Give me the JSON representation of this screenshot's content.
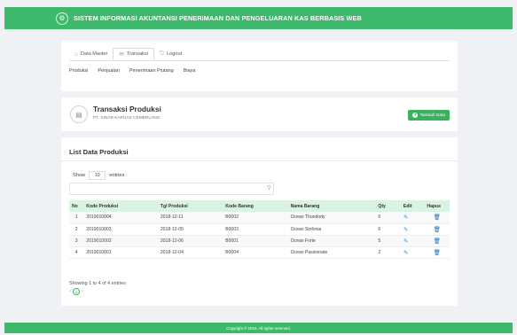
{
  "header": {
    "title": "SISTEM INFORMASI AKUNTANSI PENERIMAAN DAN PENGELUARAN KAS BERBASIS WEB",
    "logo_icon": "emblem-icon"
  },
  "nav": {
    "tabs": [
      {
        "label": "Data Master",
        "icon": "home-icon"
      },
      {
        "label": "Transaksi",
        "icon": "mail-icon"
      },
      {
        "label": "Logout",
        "icon": "logout-icon"
      }
    ],
    "subnav": [
      "Produksi",
      "Penjualan",
      "Penerimaan Piutang",
      "Biaya"
    ]
  },
  "page": {
    "title": "Transaksi Produksi",
    "subtitle": "PT. SINAR KAPUAS CEMERLANG",
    "add_button": "Tambah Data"
  },
  "list": {
    "title": "List Data Produksi",
    "show_label": "Show",
    "length_value": "10",
    "entries_label": "entries",
    "columns": [
      "No",
      "Kode Produksi",
      "Tgl Produksi",
      "Kode Barang",
      "Nama Barang",
      "Qty",
      "Edit",
      "Hapus"
    ],
    "rows": [
      [
        "1",
        "2019010004",
        "2018-12-11",
        "B0002",
        "Ocean Thundody",
        "6"
      ],
      [
        "2",
        "2019010003",
        "2018-12-05",
        "B0003",
        "Ocean Sinfonia",
        "6"
      ],
      [
        "3",
        "2019010002",
        "2018-12-06",
        "B0001",
        "Ocean Forte",
        "5"
      ],
      [
        "4",
        "2019010001",
        "2018-12-04",
        "B0004",
        "Ocean Passionate",
        "2"
      ]
    ],
    "info": "Showing 1 to 4 of 4 entries",
    "pager": {
      "prev": "‹",
      "current": "1",
      "next": "›"
    }
  },
  "footer": {
    "text": "Copyright © 2018. All rights reserved."
  },
  "colors": {
    "brand": "#3eb96c",
    "table_header": "#d9f2e2",
    "edit": "#1d93d2",
    "delete": "#1d6fb8"
  }
}
